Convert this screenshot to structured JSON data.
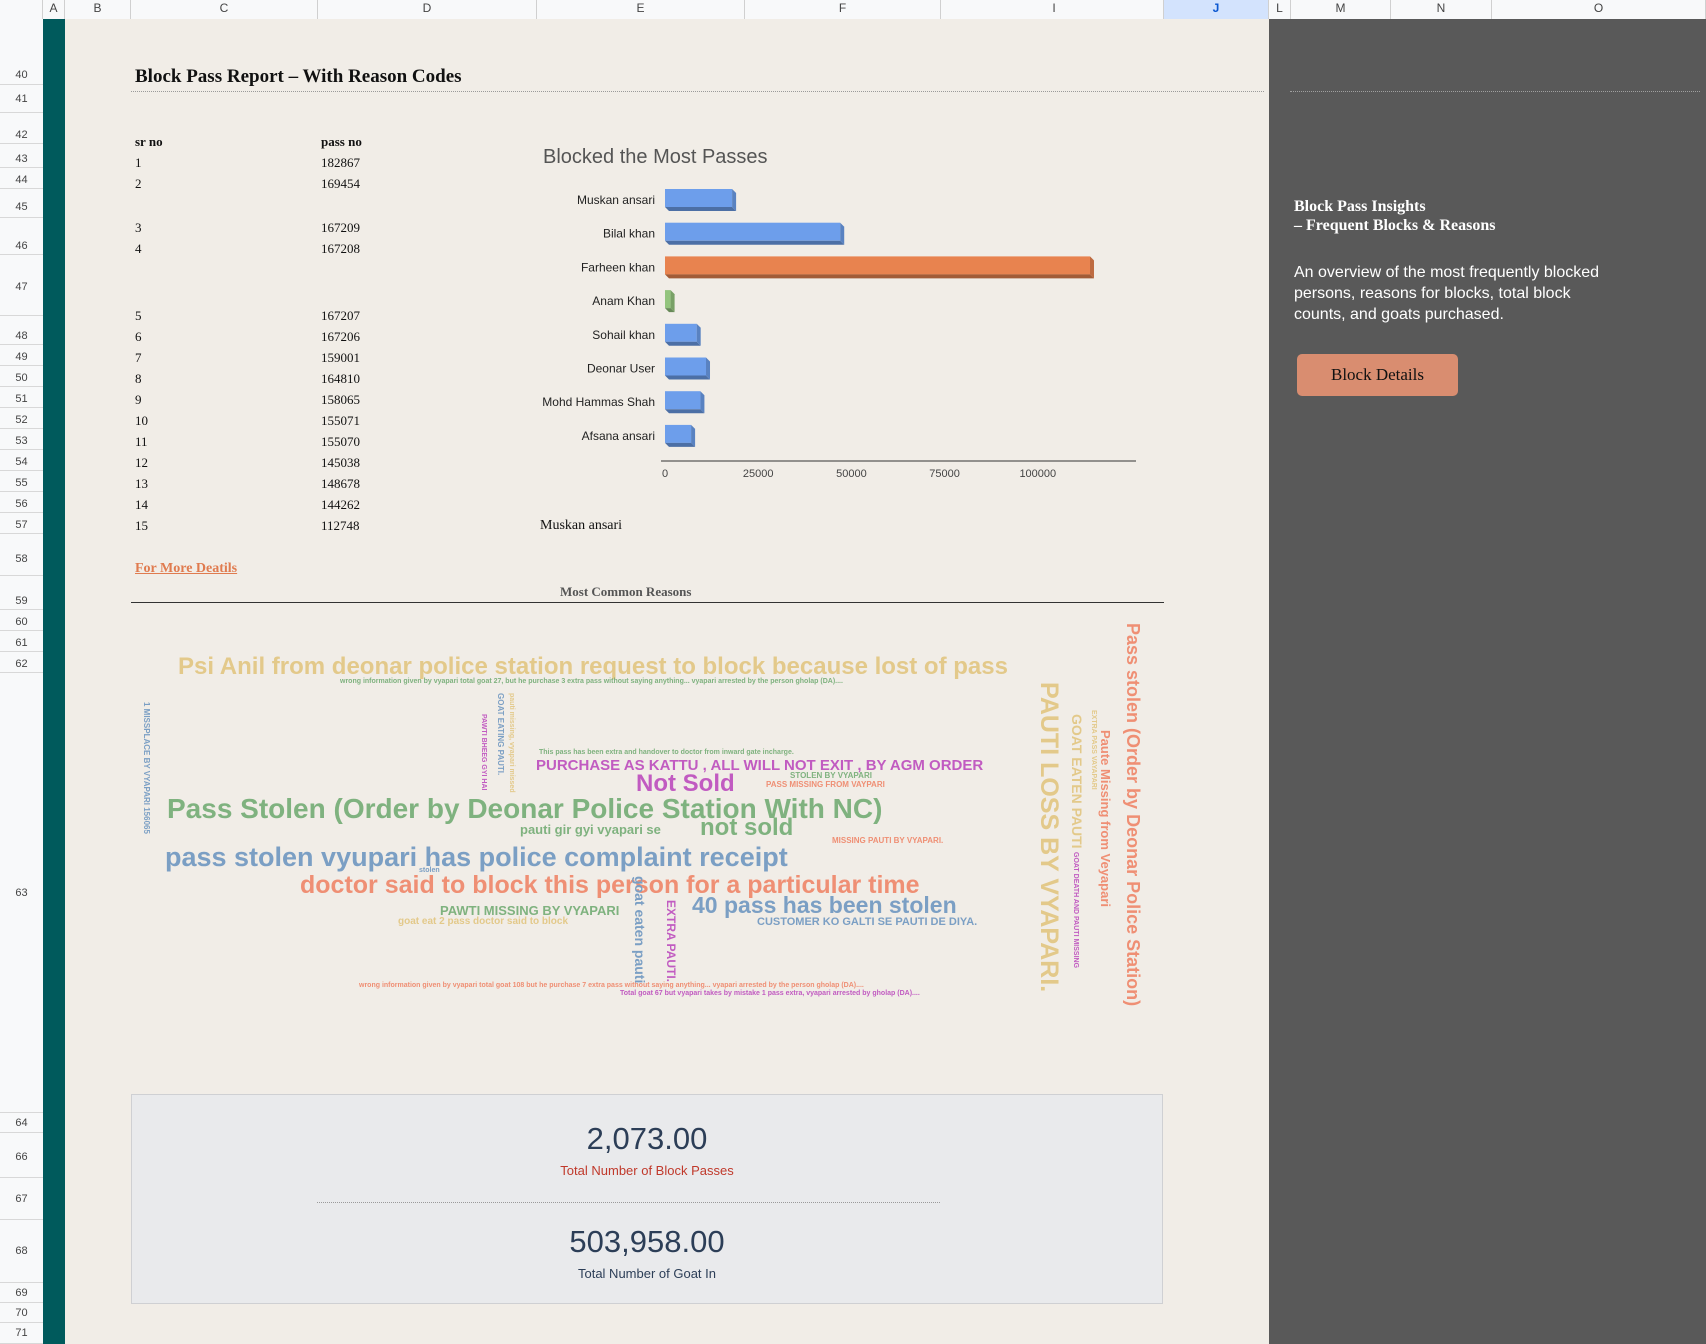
{
  "columns": [
    "A",
    "B",
    "C",
    "D",
    "E",
    "F",
    "I",
    "J",
    "L",
    "M",
    "N",
    "O"
  ],
  "selected_column": "J",
  "rows": [
    "40",
    "41",
    "42",
    "43",
    "44",
    "45",
    "46",
    "47",
    "48",
    "49",
    "50",
    "51",
    "52",
    "53",
    "54",
    "55",
    "56",
    "57",
    "58",
    "59",
    "60",
    "61",
    "62",
    "63",
    "64",
    "66",
    "67",
    "68",
    "69",
    "70",
    "71"
  ],
  "report": {
    "title": "Block Pass Report – With Reason Codes",
    "col_sr": "sr no",
    "col_pass": "pass no",
    "entries": [
      {
        "sr": "1",
        "pass": "182867"
      },
      {
        "sr": "2",
        "pass": "169454"
      },
      {
        "sr": "3",
        "pass": "167209"
      },
      {
        "sr": "4",
        "pass": "167208"
      },
      {
        "sr": "5",
        "pass": "167207"
      },
      {
        "sr": "6",
        "pass": "167206"
      },
      {
        "sr": "7",
        "pass": "159001"
      },
      {
        "sr": "8",
        "pass": "164810"
      },
      {
        "sr": "9",
        "pass": "158065"
      },
      {
        "sr": "10",
        "pass": "155071"
      },
      {
        "sr": "11",
        "pass": "155070"
      },
      {
        "sr": "12",
        "pass": "145038"
      },
      {
        "sr": "13",
        "pass": "148678"
      },
      {
        "sr": "14",
        "pass": "144262"
      },
      {
        "sr": "15",
        "pass": "112748"
      }
    ],
    "selected_name": "Muskan ansari",
    "more_link": "For More Deatils"
  },
  "chart_data": {
    "type": "bar",
    "orientation": "horizontal",
    "title": "Blocked the Most Passes",
    "categories": [
      "Muskan ansari",
      "Bilal khan",
      "Farheen khan",
      "Anam Khan",
      "Sohail khan",
      "Deonar User",
      "Mohd Hammas Shah",
      "Afsana ansari"
    ],
    "values": [
      18000,
      47000,
      114000,
      1500,
      8500,
      11000,
      9500,
      7000
    ],
    "colors": [
      "#6d9eeb",
      "#6d9eeb",
      "#e8834f",
      "#93c47d",
      "#6d9eeb",
      "#6d9eeb",
      "#6d9eeb",
      "#6d9eeb"
    ],
    "xticks": [
      "0",
      "25000",
      "50000",
      "75000",
      "100000"
    ],
    "xlim": [
      0,
      125000
    ],
    "grid": false,
    "legend": "none"
  },
  "reasons": {
    "title": "Most Common Reasons",
    "words": [
      {
        "text": "Psi Anil from deonar police station request to block because lost of pass",
        "color": "#e3c98a"
      },
      {
        "text": "wrong information given by vyapari total goat 27, but he purchase 3 extra pass without saying anything... vyapari arrested by the person gholap (DA)....",
        "color": "#7fb27f"
      },
      {
        "text": "This pass has been extra and handover to doctor from inward gate incharge.",
        "color": "#7fb27f"
      },
      {
        "text": "PURCHASE AS KATTU , ALL WILL NOT EXIT , BY AGM ORDER",
        "color": "#c15bc1"
      },
      {
        "text": "Not Sold",
        "color": "#c15bc1"
      },
      {
        "text": "STOLEN BY VYAPARI",
        "color": "#7fb27f"
      },
      {
        "text": "PASS MISSING FROM VAYPARI",
        "color": "#ef8f74"
      },
      {
        "text": "Pass Stolen (Order by Deonar Police Station With NC)",
        "color": "#7fb27f"
      },
      {
        "text": "pauti gir gyi vyapari se",
        "color": "#7fb27f"
      },
      {
        "text": "not sold",
        "color": "#7fb27f"
      },
      {
        "text": "MISSING PAUTI BY VYAPARI.",
        "color": "#ef8f74"
      },
      {
        "text": "pass stolen vyupari has police complaint receipt",
        "color": "#7b9fc4"
      },
      {
        "text": "stolen",
        "color": "#7b9fc4"
      },
      {
        "text": "doctor said to block this person for a particular time",
        "color": "#ef8f74"
      },
      {
        "text": "PAWTI MISSING BY VYAPARI",
        "color": "#7fb27f"
      },
      {
        "text": "40 pass has been stolen",
        "color": "#7b9fc4"
      },
      {
        "text": "goat eat 2 pass doctor said to block",
        "color": "#e3c98a"
      },
      {
        "text": "CUSTOMER KO GALTI SE PAUTI DE DIYA.",
        "color": "#7b9fc4"
      },
      {
        "text": "wrong information given by vyapari total goat 108 but he purchase 7 extra pass without saying anything... vyapari arrested by the person gholap (DA)....",
        "color": "#ef8f74"
      },
      {
        "text": "Total goat 67 but vyapari takes by mistake 1 pass extra, vyapari arrested by gholap (DA)....",
        "color": "#c15bc1"
      },
      {
        "text": "1 MISSPLACE BY VYAPARI 156065",
        "color": "#7b9fc4"
      },
      {
        "text": "GOAT EATING PAUTI.",
        "color": "#7b9fc4"
      },
      {
        "text": "pauti missing, vyapari missed",
        "color": "#e3c98a"
      },
      {
        "text": "PAWTI BHEEG GYI HAI",
        "color": "#c15bc1"
      },
      {
        "text": "goat eaten pauti",
        "color": "#7b9fc4"
      },
      {
        "text": "EXTRA PAUTI.",
        "color": "#c15bc1"
      },
      {
        "text": "PAUTI LOSS BY VYAPARI.",
        "color": "#e3c98a"
      },
      {
        "text": "GOAT EATEN PAUTI",
        "color": "#e3c98a"
      },
      {
        "text": "EXTRA PASS VAYAPARI",
        "color": "#e3c98a"
      },
      {
        "text": "Paute Missing from Veyapari",
        "color": "#ef8f74"
      },
      {
        "text": "GOAT DEATH AND PAUTI MISSING",
        "color": "#c15bc1"
      },
      {
        "text": "Pass stolen (Order by Deonar Police Station)",
        "color": "#ef8f74"
      }
    ]
  },
  "kpis": [
    {
      "value": "2,073.00",
      "label": "Total Number of Block Passes",
      "label_color": "#c0392b"
    },
    {
      "value": "503,958.00",
      "label": "Total Number of Goat In",
      "label_color": "#2c3e57"
    }
  ],
  "sidebar": {
    "title_line1": "Block Pass Insights",
    "title_line2": "– Frequent Blocks & Reasons",
    "description": "An overview of the most frequently blocked persons, reasons for blocks, total block counts, and goats purchased.",
    "button_label": "Block Details"
  }
}
